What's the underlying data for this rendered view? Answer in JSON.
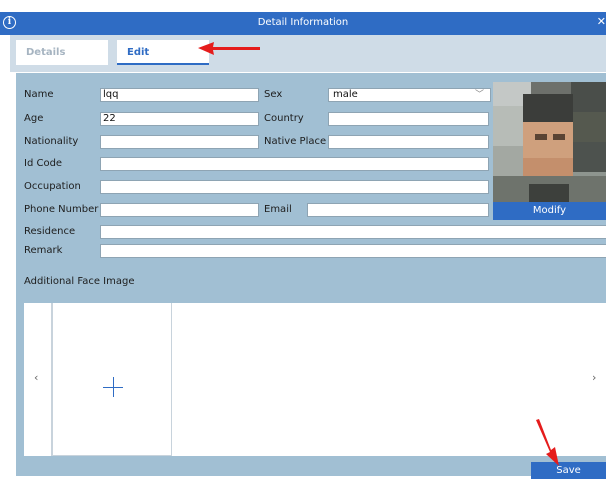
{
  "window": {
    "title": "Detail Information",
    "info_icon": "info-icon",
    "close_icon": "close-icon"
  },
  "tabs": [
    {
      "label": "Details"
    },
    {
      "label": "Edit"
    }
  ],
  "form": {
    "name": {
      "label": "Name",
      "value": "lqq"
    },
    "sex": {
      "label": "Sex",
      "value": "male"
    },
    "age": {
      "label": "Age",
      "value": "22"
    },
    "country": {
      "label": "Country",
      "value": ""
    },
    "nationality": {
      "label": "Nationality",
      "value": ""
    },
    "native_place": {
      "label": "Native Place",
      "value": ""
    },
    "id_code": {
      "label": "Id Code",
      "value": ""
    },
    "occupation": {
      "label": "Occupation",
      "value": ""
    },
    "phone": {
      "label": "Phone Number",
      "value": ""
    },
    "email": {
      "label": "Email",
      "value": ""
    },
    "residence": {
      "label": "Residence",
      "value": ""
    },
    "remark": {
      "label": "Remark",
      "value": ""
    }
  },
  "photo": {
    "modify_label": "Modify"
  },
  "additional": {
    "label": "Additional Face Image",
    "prev_icon": "chevron-left-icon",
    "next_icon": "chevron-right-icon",
    "add_icon": "plus-icon"
  },
  "footer": {
    "save_label": "Save"
  },
  "colors": {
    "accent": "#2f6cc4",
    "panel": "#a1bfd3",
    "tabbar": "#cfdce7",
    "annotation_arrow": "#e51c1c"
  }
}
